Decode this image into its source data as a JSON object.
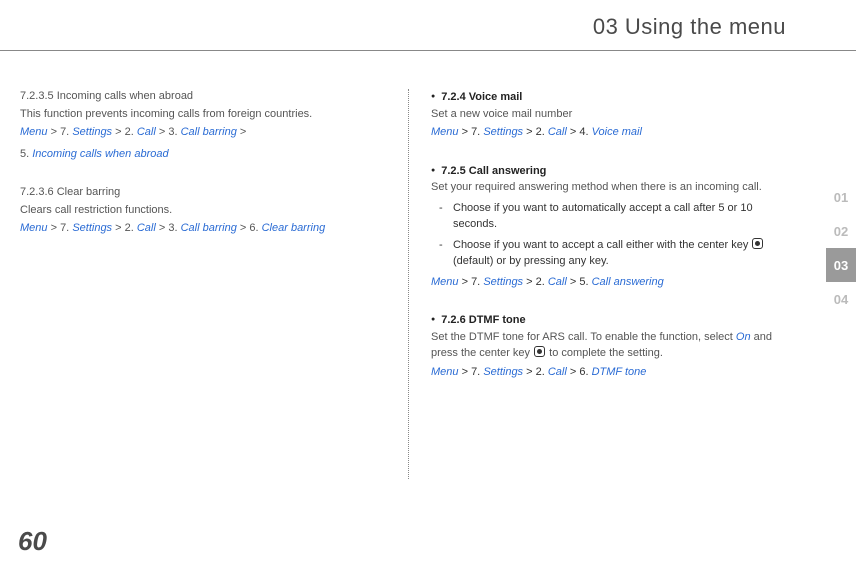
{
  "header": {
    "title": "03 Using the menu"
  },
  "pageNumber": "60",
  "sideTabs": {
    "t1": "01",
    "t2": "02",
    "t3": "03",
    "t4": "04"
  },
  "left": {
    "s1": {
      "head": "7.2.3.5  Incoming calls when abroad",
      "desc": "This function prevents incoming calls from foreign countries.",
      "p_menu": "Menu",
      "p1": " > 7. ",
      "p_settings": "Settings",
      "p2": " > 2. ",
      "p_call": "Call",
      "p3": " > 3. ",
      "p_cb": "Call barring",
      "p4": " >",
      "p5_pre": "5. ",
      "p5": "Incoming calls when abroad"
    },
    "s2": {
      "head": "7.2.3.6  Clear barring",
      "desc": "Clears call restriction functions.",
      "p_menu": "Menu",
      "p1": " > 7. ",
      "p_settings": "Settings",
      "p2": " > 2. ",
      "p_call": "Call",
      "p3": " > 3. ",
      "p_cb": "Call barring",
      "p4": " > 6. ",
      "p_clear": "Clear barring"
    }
  },
  "right": {
    "s1": {
      "head": "7.2.4  Voice mail",
      "desc": "Set a new voice mail number",
      "p_menu": "Menu",
      "p1": " > 7. ",
      "p_settings": "Settings",
      "p2": " > 2. ",
      "p_call": "Call",
      "p3": " > 4. ",
      "p_vm": "Voice mail"
    },
    "s2": {
      "head": "7.2.5  Call answering",
      "desc": "Set your required answering method when there is an incoming call.",
      "d1": "Choose if you want to automatically accept a call after 5 or 10 seconds.",
      "d2a": "Choose if you want to accept a call either with the center key ",
      "d2b": " (default) or by pressing any key.",
      "p_menu": "Menu",
      "p1": " > 7. ",
      "p_settings": "Settings",
      "p2": " > 2. ",
      "p_call": "Call",
      "p3": " > 5. ",
      "p_ca": "Call answering"
    },
    "s3": {
      "head": "7.2.6  DTMF tone",
      "desc1": "Set the DTMF tone for ARS call. To enable the function, select ",
      "on": "On",
      "desc2": " and press the center key ",
      "desc3": " to complete the setting.",
      "p_menu": "Menu",
      "p1": " > 7. ",
      "p_settings": "Settings",
      "p2": " > 2. ",
      "p_call": "Call",
      "p3": " > 6. ",
      "p_dt": "DTMF tone"
    }
  }
}
